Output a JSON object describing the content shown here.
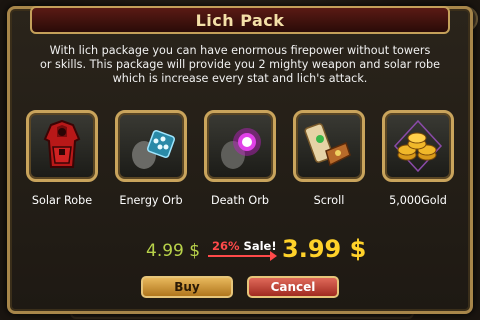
{
  "dialog": {
    "title": "Lich Pack",
    "description_lines": [
      "With lich package you can have enormous firepower without towers",
      "or skills. This package will provide you 2 mighty weapon and solar robe",
      "which is increase every stat and lich's attack."
    ]
  },
  "items": [
    {
      "label": "Solar Robe",
      "icon": "robe-icon"
    },
    {
      "label": "Energy Orb",
      "icon": "energy-orb-icon"
    },
    {
      "label": "Death Orb",
      "icon": "death-orb-icon"
    },
    {
      "label": "Scroll",
      "icon": "scroll-icon"
    },
    {
      "label": "5,000Gold",
      "icon": "gold-coins-icon"
    }
  ],
  "price": {
    "original": "4.99 $",
    "sale_percent": "26%",
    "sale_text": "Sale!",
    "current": "3.99 $"
  },
  "buttons": {
    "buy": "Buy",
    "cancel": "Cancel"
  },
  "colors": {
    "old_price": "#b8d24a",
    "new_price": "#ffd22a",
    "sale": "#ff4a4a",
    "frame": "#c9a45c"
  }
}
